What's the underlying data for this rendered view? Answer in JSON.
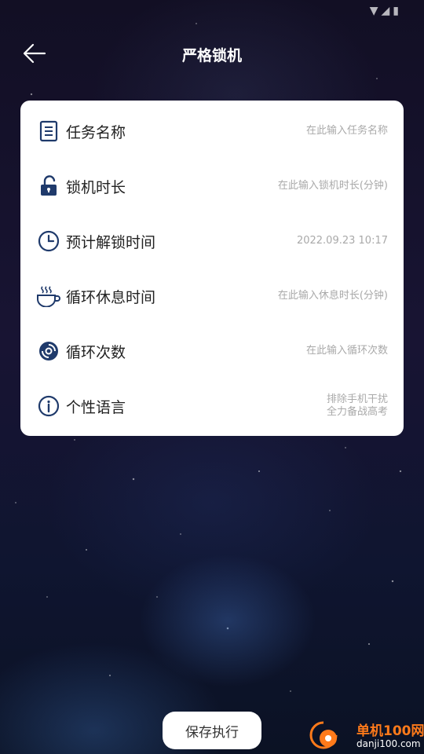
{
  "header": {
    "title": "严格锁机"
  },
  "form": {
    "rows": [
      {
        "label": "任务名称",
        "value": "在此输入任务名称",
        "icon": "document-icon"
      },
      {
        "label": "锁机时长",
        "value": "在此输入锁机时长(分钟)",
        "icon": "unlock-icon"
      },
      {
        "label": "预计解锁时间",
        "value": "2022.09.23 10:17",
        "icon": "clock-icon"
      },
      {
        "label": "循环休息时间",
        "value": "在此输入休息时长(分钟)",
        "icon": "coffee-cup-icon"
      },
      {
        "label": "循环次数",
        "value": "在此输入循环次数",
        "icon": "cycle-icon"
      },
      {
        "label": "个性语言",
        "value_line1": "排除手机干扰",
        "value_line2": "全力备战高考",
        "icon": "info-icon"
      }
    ]
  },
  "actions": {
    "save_label": "保存执行"
  },
  "watermark": {
    "brand": "单机100网",
    "domain": "danji100.com"
  },
  "colors": {
    "icon_color": "#1f3a6b",
    "card_bg": "#ffffff",
    "label_text": "#222222",
    "hint_text": "#a9a9a9",
    "watermark_orange": "#ff7a1a"
  }
}
